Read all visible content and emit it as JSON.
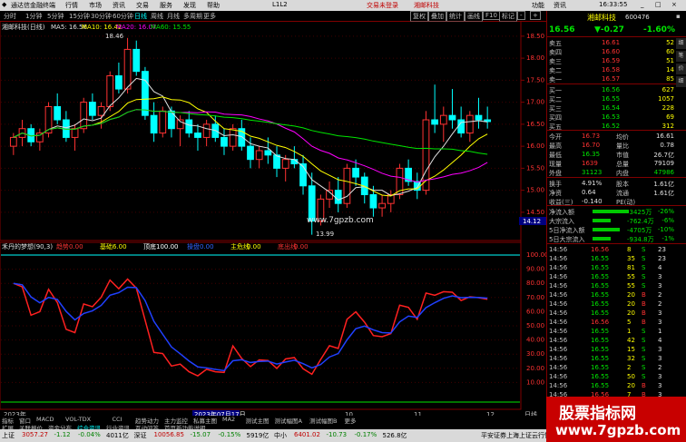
{
  "window": {
    "title": "通达信金融终端",
    "menu": [
      "行情",
      "市场",
      "资讯",
      "交易",
      "服务",
      "发现",
      "帮助"
    ],
    "center_text": "交易未登录",
    "center_text2": "湘邮科技",
    "id_text": "L1L2",
    "right_menu": [
      "功能",
      "资讯"
    ],
    "time": "16:33:55"
  },
  "toolbar": {
    "periods": [
      "分时",
      "1分钟",
      "5分钟",
      "15分钟",
      "30分钟",
      "60分钟",
      "日线",
      "周线",
      "月线",
      "多周期",
      "更多"
    ],
    "active_period": "日线",
    "buttons": [
      "复权",
      "叠加",
      "统计",
      "画线",
      "F10",
      "标记",
      "-",
      "+"
    ]
  },
  "main_chart": {
    "legend_title": "湘邮科技(日线)",
    "ma5": "MA5: 16.56",
    "ma10": "MA10: 16.42",
    "ma20": "MA20: 16.07",
    "ma60": "MA60: 15.55",
    "high_label": "18.46",
    "low_label": "13.99",
    "watermark": "www.7gpzb.com",
    "current_price_tag": "14.12",
    "y_ticks": [
      "18.50",
      "18.00",
      "17.50",
      "17.00",
      "16.50",
      "16.00",
      "15.50",
      "15.00",
      "14.50"
    ]
  },
  "indicator": {
    "name": "禾丹的梦想(90,3)",
    "fields": [
      {
        "label": "趋势",
        "value": "0.00",
        "color": "#ff3232"
      },
      {
        "label": "基础",
        "value": "6.00",
        "color": "#ffff00"
      },
      {
        "label": "顶底",
        "value": "100.00",
        "color": "#ffffff"
      },
      {
        "label": "操盘",
        "value": "0.00",
        "color": "#3264ff"
      },
      {
        "label": "主危线",
        "value": "0.00",
        "color": "#ffff00"
      },
      {
        "label": "底出线",
        "value": "0.00",
        "color": "#ff3232"
      }
    ],
    "y_ticks": [
      "100.00",
      "90.00",
      "80.00",
      "70.00",
      "60.00",
      "50.00",
      "40.00",
      "30.00",
      "20.00",
      "10.00"
    ]
  },
  "x_axis": {
    "labels": [
      "2023年",
      "2023年07月17日",
      "10",
      "11",
      "12"
    ],
    "right_label": "日线"
  },
  "tabs": {
    "row1": [
      "指标",
      "窗口",
      "MACD",
      "VOL-TDX",
      "CCI",
      "趋势动力",
      "主力监控",
      "私募主图",
      "MA2",
      "测试主图",
      "测试幅图A",
      "测试幅图B",
      "更多"
    ],
    "row2": [
      "扩展",
      "关联报价",
      "资金分布",
      "综合资讯",
      "行业资讯",
      "互动问答",
      "首页新功能说明"
    ]
  },
  "quote": {
    "name": "湘邮科技",
    "code": "600476",
    "price": "16.56",
    "change": "▼-0.27",
    "pct": "-1.60%",
    "asks": [
      {
        "label": "卖五",
        "price": "16.61",
        "vol": "52"
      },
      {
        "label": "卖四",
        "price": "16.60",
        "vol": "60"
      },
      {
        "label": "卖三",
        "price": "16.59",
        "vol": "51"
      },
      {
        "label": "卖二",
        "price": "16.58",
        "vol": "14"
      },
      {
        "label": "卖一",
        "price": "16.57",
        "vol": "85"
      }
    ],
    "bids": [
      {
        "label": "买一",
        "price": "16.56",
        "vol": "627"
      },
      {
        "label": "买二",
        "price": "16.55",
        "vol": "1057"
      },
      {
        "label": "买三",
        "price": "16.54",
        "vol": "228"
      },
      {
        "label": "买四",
        "price": "16.53",
        "vol": "69"
      },
      {
        "label": "买五",
        "price": "16.52",
        "vol": "312"
      }
    ],
    "stats": [
      [
        "今开",
        "16.73",
        "均价",
        "16.61"
      ],
      [
        "最高",
        "16.70",
        "量比",
        "0.78"
      ],
      [
        "最低",
        "16.35",
        "市值",
        "26.7亿"
      ],
      [
        "现量",
        "1639",
        "总量",
        "79109"
      ],
      [
        "外盘",
        "31123",
        "内盘",
        "47986"
      ]
    ],
    "stats2": [
      [
        "换手",
        "4.91%",
        "股本",
        "1.61亿"
      ],
      [
        "净资",
        "0.64",
        "流通",
        "1.61亿"
      ],
      [
        "收益(三)",
        "-0.140",
        "PE(动)",
        ""
      ]
    ],
    "flows": [
      {
        "label": "净流入额",
        "value": "-3425万",
        "pct": "-26%"
      },
      {
        "label": "大宗流入",
        "value": "-762.4万",
        "pct": "-6%"
      },
      {
        "label": "5日净流入额",
        "value": "-4705万",
        "pct": "-10%"
      },
      {
        "label": "5日大宗流入",
        "value": "-934.8万",
        "pct": "-1%"
      }
    ],
    "ticks": [
      [
        "14:56",
        "16.56",
        "8",
        "S",
        "23"
      ],
      [
        "14:56",
        "16.55",
        "35",
        "S",
        "23"
      ],
      [
        "14:56",
        "16.55",
        "81",
        "S",
        "4"
      ],
      [
        "14:56",
        "16.55",
        "55",
        "S",
        "3"
      ],
      [
        "14:56",
        "16.55",
        "55",
        "S",
        "3"
      ],
      [
        "14:56",
        "16.55",
        "20",
        "B",
        "2"
      ],
      [
        "14:56",
        "16.55",
        "20",
        "B",
        "2"
      ],
      [
        "14:56",
        "16.55",
        "20",
        "B",
        "3"
      ],
      [
        "14:56",
        "16.56",
        "5",
        "B",
        "3"
      ],
      [
        "14:56",
        "16.55",
        "1",
        "S",
        "1"
      ],
      [
        "14:56",
        "16.55",
        "42",
        "S",
        "4"
      ],
      [
        "14:56",
        "16.55",
        "15",
        "S",
        "3"
      ],
      [
        "14:56",
        "16.55",
        "32",
        "S",
        "3"
      ],
      [
        "14:56",
        "16.55",
        "2",
        "S",
        "2"
      ],
      [
        "14:56",
        "16.55",
        "50",
        "S",
        "3"
      ],
      [
        "14:56",
        "16.55",
        "20",
        "B",
        "3"
      ],
      [
        "14:56",
        "16.56",
        "7",
        "B",
        "3"
      ]
    ],
    "sidebar_tabs": [
      "细",
      "笔",
      "价",
      "细"
    ]
  },
  "ad": {
    "line1": "股票指标网",
    "line2": "www.7gpzb.com"
  },
  "status": {
    "items": [
      {
        "label": "上证",
        "value": "3057.27",
        "chg": "-1.12",
        "pct": "-0.04%",
        "amt": "4011亿"
      },
      {
        "label": "深证",
        "value": "10056.85",
        "chg": "-15.07",
        "pct": "-0.15%",
        "amt": "5919亿"
      },
      {
        "label": "中小",
        "value": "6401.02",
        "chg": "-10.73",
        "pct": "-0.17%",
        "amt": "526.8亿"
      }
    ],
    "right_text": "平安证券上海上证云行情"
  },
  "chart_data": {
    "type": "candlestick",
    "candles": [
      [
        16.0,
        16.3,
        15.8,
        16.2
      ],
      [
        16.2,
        16.6,
        16.0,
        16.4
      ],
      [
        16.4,
        16.5,
        16.0,
        16.1
      ],
      [
        16.1,
        16.4,
        15.9,
        16.3
      ],
      [
        16.3,
        17.0,
        16.2,
        16.9
      ],
      [
        16.9,
        17.2,
        16.5,
        16.6
      ],
      [
        16.6,
        16.8,
        16.1,
        16.2
      ],
      [
        16.2,
        16.5,
        15.9,
        16.4
      ],
      [
        16.4,
        17.1,
        16.3,
        17.0
      ],
      [
        17.0,
        17.2,
        16.6,
        16.7
      ],
      [
        16.7,
        17.0,
        16.4,
        16.9
      ],
      [
        16.9,
        17.7,
        16.8,
        17.6
      ],
      [
        17.6,
        17.9,
        17.2,
        17.3
      ],
      [
        17.3,
        18.46,
        17.2,
        18.2
      ],
      [
        18.2,
        18.4,
        17.6,
        17.7
      ],
      [
        17.7,
        17.8,
        16.6,
        16.7
      ],
      [
        16.7,
        17.0,
        16.1,
        16.3
      ],
      [
        16.3,
        16.9,
        16.2,
        16.8
      ],
      [
        16.8,
        16.9,
        16.2,
        16.4
      ],
      [
        16.4,
        16.7,
        16.0,
        16.6
      ],
      [
        16.6,
        16.8,
        16.2,
        16.3
      ],
      [
        16.3,
        16.5,
        15.9,
        16.2
      ],
      [
        16.2,
        16.6,
        16.0,
        16.5
      ],
      [
        16.5,
        16.7,
        16.1,
        16.2
      ],
      [
        16.2,
        16.4,
        15.8,
        16.0
      ],
      [
        16.0,
        16.5,
        15.9,
        16.4
      ],
      [
        16.4,
        16.6,
        15.9,
        16.0
      ],
      [
        16.0,
        16.2,
        15.5,
        15.7
      ],
      [
        15.7,
        16.0,
        15.5,
        15.9
      ],
      [
        15.9,
        16.2,
        15.6,
        15.8
      ],
      [
        15.8,
        16.0,
        15.3,
        15.5
      ],
      [
        15.5,
        15.8,
        15.2,
        15.7
      ],
      [
        15.7,
        16.0,
        15.5,
        15.6
      ],
      [
        15.6,
        15.8,
        14.9,
        15.1
      ],
      [
        15.1,
        15.4,
        13.99,
        14.3
      ],
      [
        14.3,
        14.9,
        14.2,
        14.8
      ],
      [
        14.8,
        15.2,
        14.6,
        15.0
      ],
      [
        15.0,
        15.3,
        14.5,
        14.7
      ],
      [
        14.7,
        15.6,
        14.6,
        15.5
      ],
      [
        15.5,
        15.7,
        15.1,
        15.3
      ],
      [
        15.3,
        15.4,
        14.7,
        14.9
      ],
      [
        14.9,
        15.1,
        14.4,
        14.6
      ],
      [
        14.6,
        14.9,
        14.4,
        14.7
      ],
      [
        14.7,
        15.0,
        14.5,
        14.9
      ],
      [
        14.9,
        15.6,
        14.8,
        15.5
      ],
      [
        15.5,
        15.7,
        15.1,
        15.2
      ],
      [
        15.2,
        15.4,
        14.8,
        15.0
      ],
      [
        15.0,
        16.8,
        14.9,
        16.6
      ],
      [
        16.6,
        17.4,
        16.3,
        16.5
      ],
      [
        16.5,
        16.9,
        16.1,
        16.7
      ],
      [
        16.7,
        17.3,
        16.4,
        16.6
      ],
      [
        16.6,
        16.9,
        16.2,
        16.3
      ],
      [
        16.3,
        16.8,
        16.1,
        16.7
      ],
      [
        16.7,
        17.1,
        16.4,
        16.6
      ],
      [
        16.6,
        16.9,
        16.4,
        16.56
      ]
    ],
    "ylim": [
      13.9,
      18.6
    ]
  }
}
